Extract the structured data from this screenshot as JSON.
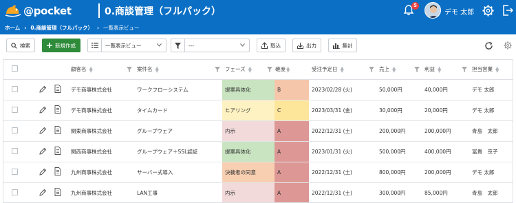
{
  "header": {
    "brand": "@pocket",
    "app_title": "0.商談管理（フルパック）",
    "notification_count": "5",
    "user_name": "デモ 太郎"
  },
  "breadcrumb": {
    "home": "ホーム",
    "app": "0.商談管理（フルパック）",
    "view": "一覧表示ビュー"
  },
  "toolbar": {
    "search_label": "検索",
    "new_label": "新規作成",
    "view_select": "一覧表示ビュー",
    "filter_select": "---",
    "import_label": "取込",
    "export_label": "出力",
    "aggregate_label": "集計"
  },
  "table": {
    "columns": [
      "顧客名",
      "案件名",
      "フェーズ",
      "確度",
      "受注予定日",
      "売上",
      "利益",
      "担当営業"
    ],
    "rows": [
      {
        "customer": "デモ商事株式会社",
        "project": "ワークフローシステム",
        "phase": "提案具体化",
        "accuracy": "B",
        "date": "2023/02/28 (火)",
        "sales": "50,000円",
        "profit": "40,000円",
        "rep": "デモ 太郎"
      },
      {
        "customer": "デモ商事株式会社",
        "project": "タイムカード",
        "phase": "ヒアリング",
        "accuracy": "C",
        "date": "2023/03/31 (金)",
        "sales": "30,000円",
        "profit": "20,000円",
        "rep": "デモ 太郎"
      },
      {
        "customer": "関東商事株式会社",
        "project": "グループウェア",
        "phase": "内示",
        "accuracy": "A",
        "date": "2022/12/31 (土)",
        "sales": "200,000円",
        "profit": "200,000円",
        "rep": "青島　太郎"
      },
      {
        "customer": "関西商事株式会社",
        "project": "グループウェア＋SSL認証",
        "phase": "提案具体化",
        "accuracy": "A",
        "date": "2023/01/31 (火)",
        "sales": "500,000円",
        "profit": "400,000円",
        "rep": "冨貴　京子"
      },
      {
        "customer": "九州商事株式会社",
        "project": "サーバー式導入",
        "phase": "決裁者の同意",
        "accuracy": "A",
        "date": "2022/12/31 (土)",
        "sales": "800,000円",
        "profit": "200,000円",
        "rep": "デモ 太郎"
      },
      {
        "customer": "九州商事株式会社",
        "project": "LAN工事",
        "phase": "内示",
        "accuracy": "A",
        "date": "2022/12/31 (土)",
        "sales": "300,000円",
        "profit": "85,000円",
        "rep": "青島　太郎"
      }
    ]
  },
  "colors": {
    "header_blue": "#0b6fc5",
    "new_button_green": "#2e8b3a",
    "phase_teigen": "#c9e4c0",
    "phase_hearing": "#fff2c2",
    "phase_naiji": "#f2dadb",
    "phase_kessai": "#f8cfb1",
    "accuracy_a": "#dd9896",
    "accuracy_b": "#f6c6ab",
    "accuracy_c": "#fde59a"
  },
  "icons": [
    "logo-icon",
    "bell-icon",
    "user-avatar",
    "settings-gear-icon",
    "logout-icon",
    "search-icon",
    "plus-icon",
    "list-view-icon",
    "filter-icon",
    "import-icon",
    "export-icon",
    "chart-icon",
    "refresh-icon",
    "edit-pencil-icon",
    "document-icon"
  ]
}
